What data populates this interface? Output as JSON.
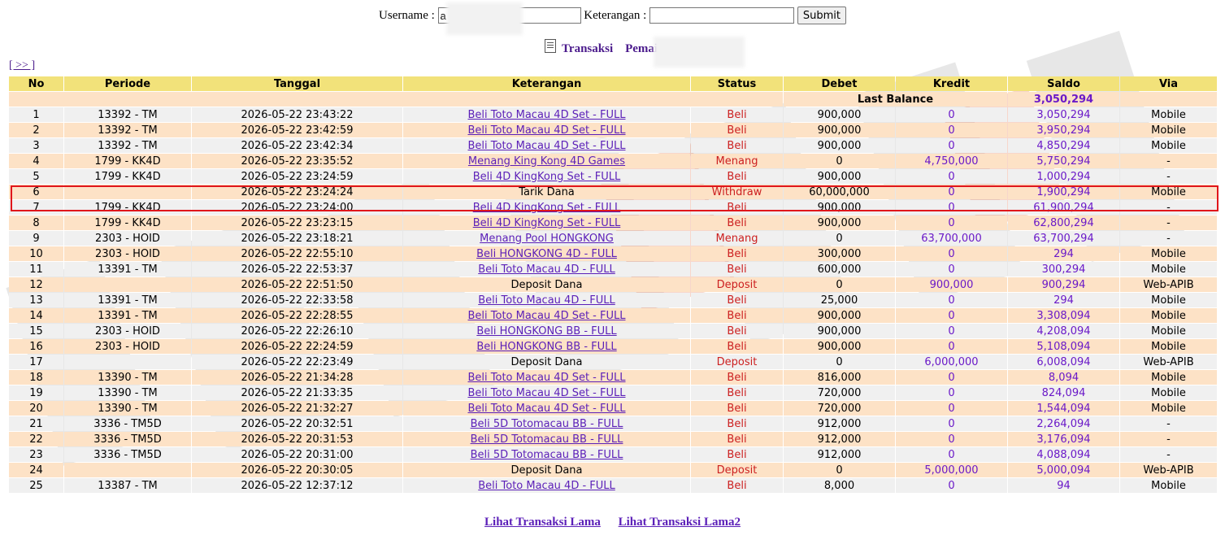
{
  "form": {
    "username_label": "Username :",
    "username_value": "a",
    "keterangan_label": "Keterangan :",
    "keterangan_value": "",
    "submit_label": "Submit"
  },
  "heading": {
    "title": "Transaksi",
    "player_label": "Pemain :",
    "player_value": "a"
  },
  "nav": {
    "next_label": "[ >> ]"
  },
  "table": {
    "headers": [
      "No",
      "Periode",
      "Tanggal",
      "Keterangan",
      "Status",
      "Debet",
      "Kredit",
      "Saldo",
      "Via"
    ],
    "last_balance_label": "Last Balance",
    "last_balance_value": "3,050,294",
    "rows": [
      {
        "no": "1",
        "periode": "13392 - TM",
        "tanggal": "2026-05-22 23:43:22",
        "keterangan": "Beli Toto Macau 4D Set - FULL",
        "link": true,
        "status": "Beli",
        "debet": "900,000",
        "kredit": "0",
        "saldo": "3,050,294",
        "via": "Mobile"
      },
      {
        "no": "2",
        "periode": "13392 - TM",
        "tanggal": "2026-05-22 23:42:59",
        "keterangan": "Beli Toto Macau 4D Set - FULL",
        "link": true,
        "status": "Beli",
        "debet": "900,000",
        "kredit": "0",
        "saldo": "3,950,294",
        "via": "Mobile"
      },
      {
        "no": "3",
        "periode": "13392 - TM",
        "tanggal": "2026-05-22 23:42:34",
        "keterangan": "Beli Toto Macau 4D Set - FULL",
        "link": true,
        "status": "Beli",
        "debet": "900,000",
        "kredit": "0",
        "saldo": "4,850,294",
        "via": "Mobile"
      },
      {
        "no": "4",
        "periode": "1799 - KK4D",
        "tanggal": "2026-05-22 23:35:52",
        "keterangan": "Menang King Kong 4D Games",
        "link": true,
        "status": "Menang",
        "debet": "0",
        "kredit": "4,750,000",
        "saldo": "5,750,294",
        "via": "-"
      },
      {
        "no": "5",
        "periode": "1799 - KK4D",
        "tanggal": "2026-05-22 23:24:59",
        "keterangan": "Beli 4D KingKong Set - FULL",
        "link": true,
        "status": "Beli",
        "debet": "900,000",
        "kredit": "0",
        "saldo": "1,000,294",
        "via": "-"
      },
      {
        "no": "6",
        "periode": "",
        "tanggal": "2026-05-22 23:24:24",
        "keterangan": "Tarik Dana",
        "link": false,
        "status": "Withdraw",
        "debet": "60,000,000",
        "kredit": "0",
        "saldo": "1,900,294",
        "via": "Mobile"
      },
      {
        "no": "7",
        "periode": "1799 - KK4D",
        "tanggal": "2026-05-22 23:24:00",
        "keterangan": "Beli 4D KingKong Set - FULL",
        "link": true,
        "status": "Beli",
        "debet": "900,000",
        "kredit": "0",
        "saldo": "61,900,294",
        "via": "-"
      },
      {
        "no": "8",
        "periode": "1799 - KK4D",
        "tanggal": "2026-05-22 23:23:15",
        "keterangan": "Beli 4D KingKong Set - FULL",
        "link": true,
        "status": "Beli",
        "debet": "900,000",
        "kredit": "0",
        "saldo": "62,800,294",
        "via": "-"
      },
      {
        "no": "9",
        "periode": "2303 - HOID",
        "tanggal": "2026-05-22 23:18:21",
        "keterangan": "Menang Pool HONGKONG",
        "link": true,
        "status": "Menang",
        "debet": "0",
        "kredit": "63,700,000",
        "saldo": "63,700,294",
        "via": "-"
      },
      {
        "no": "10",
        "periode": "2303 - HOID",
        "tanggal": "2026-05-22 22:55:10",
        "keterangan": "Beli HONGKONG 4D - FULL",
        "link": true,
        "status": "Beli",
        "debet": "300,000",
        "kredit": "0",
        "saldo": "294",
        "via": "Mobile"
      },
      {
        "no": "11",
        "periode": "13391 - TM",
        "tanggal": "2026-05-22 22:53:37",
        "keterangan": "Beli Toto Macau 4D - FULL",
        "link": true,
        "status": "Beli",
        "debet": "600,000",
        "kredit": "0",
        "saldo": "300,294",
        "via": "Mobile"
      },
      {
        "no": "12",
        "periode": "",
        "tanggal": "2026-05-22 22:51:50",
        "keterangan": "Deposit Dana",
        "link": false,
        "status": "Deposit",
        "debet": "0",
        "kredit": "900,000",
        "saldo": "900,294",
        "via": "Web-APIB"
      },
      {
        "no": "13",
        "periode": "13391 - TM",
        "tanggal": "2026-05-22 22:33:58",
        "keterangan": "Beli Toto Macau 4D - FULL",
        "link": true,
        "status": "Beli",
        "debet": "25,000",
        "kredit": "0",
        "saldo": "294",
        "via": "Mobile"
      },
      {
        "no": "14",
        "periode": "13391 - TM",
        "tanggal": "2026-05-22 22:28:55",
        "keterangan": "Beli Toto Macau 4D Set - FULL",
        "link": true,
        "status": "Beli",
        "debet": "900,000",
        "kredit": "0",
        "saldo": "3,308,094",
        "via": "Mobile"
      },
      {
        "no": "15",
        "periode": "2303 - HOID",
        "tanggal": "2026-05-22 22:26:10",
        "keterangan": "Beli HONGKONG BB - FULL",
        "link": true,
        "status": "Beli",
        "debet": "900,000",
        "kredit": "0",
        "saldo": "4,208,094",
        "via": "Mobile"
      },
      {
        "no": "16",
        "periode": "2303 - HOID",
        "tanggal": "2026-05-22 22:24:59",
        "keterangan": "Beli HONGKONG BB - FULL",
        "link": true,
        "status": "Beli",
        "debet": "900,000",
        "kredit": "0",
        "saldo": "5,108,094",
        "via": "Mobile"
      },
      {
        "no": "17",
        "periode": "",
        "tanggal": "2026-05-22 22:23:49",
        "keterangan": "Deposit Dana",
        "link": false,
        "status": "Deposit",
        "debet": "0",
        "kredit": "6,000,000",
        "saldo": "6,008,094",
        "via": "Web-APIB"
      },
      {
        "no": "18",
        "periode": "13390 - TM",
        "tanggal": "2026-05-22 21:34:28",
        "keterangan": "Beli Toto Macau 4D Set - FULL",
        "link": true,
        "status": "Beli",
        "debet": "816,000",
        "kredit": "0",
        "saldo": "8,094",
        "via": "Mobile"
      },
      {
        "no": "19",
        "periode": "13390 - TM",
        "tanggal": "2026-05-22 21:33:35",
        "keterangan": "Beli Toto Macau 4D Set - FULL",
        "link": true,
        "status": "Beli",
        "debet": "720,000",
        "kredit": "0",
        "saldo": "824,094",
        "via": "Mobile"
      },
      {
        "no": "20",
        "periode": "13390 - TM",
        "tanggal": "2026-05-22 21:32:27",
        "keterangan": "Beli Toto Macau 4D Set - FULL",
        "link": true,
        "status": "Beli",
        "debet": "720,000",
        "kredit": "0",
        "saldo": "1,544,094",
        "via": "Mobile"
      },
      {
        "no": "21",
        "periode": "3336 - TM5D",
        "tanggal": "2026-05-22 20:32:51",
        "keterangan": "Beli 5D Totomacau BB - FULL",
        "link": true,
        "status": "Beli",
        "debet": "912,000",
        "kredit": "0",
        "saldo": "2,264,094",
        "via": "-"
      },
      {
        "no": "22",
        "periode": "3336 - TM5D",
        "tanggal": "2026-05-22 20:31:53",
        "keterangan": "Beli 5D Totomacau BB - FULL",
        "link": true,
        "status": "Beli",
        "debet": "912,000",
        "kredit": "0",
        "saldo": "3,176,094",
        "via": "-"
      },
      {
        "no": "23",
        "periode": "3336 - TM5D",
        "tanggal": "2026-05-22 20:31:00",
        "keterangan": "Beli 5D Totomacau BB - FULL",
        "link": true,
        "status": "Beli",
        "debet": "912,000",
        "kredit": "0",
        "saldo": "4,088,094",
        "via": "-"
      },
      {
        "no": "24",
        "periode": "",
        "tanggal": "2026-05-22 20:30:05",
        "keterangan": "Deposit Dana",
        "link": false,
        "status": "Deposit",
        "debet": "0",
        "kredit": "5,000,000",
        "saldo": "5,000,094",
        "via": "Web-APIB"
      },
      {
        "no": "25",
        "periode": "13387 - TM",
        "tanggal": "2026-05-22 12:37:12",
        "keterangan": "Beli Toto Macau 4D - FULL",
        "link": true,
        "status": "Beli",
        "debet": "8,000",
        "kredit": "0",
        "saldo": "94",
        "via": "Mobile"
      }
    ]
  },
  "footer": {
    "link1": "Lihat Transaksi Lama",
    "link2": "Lihat Transaksi Lama2"
  },
  "colors": {
    "header_bg": "#f2e27a",
    "row_odd_bg": "#f0f0f0",
    "row_even_bg": "#fde2c6",
    "status_red": "#cc2020",
    "link_purple": "#5b1fb8",
    "highlight_border": "#e0161b"
  }
}
